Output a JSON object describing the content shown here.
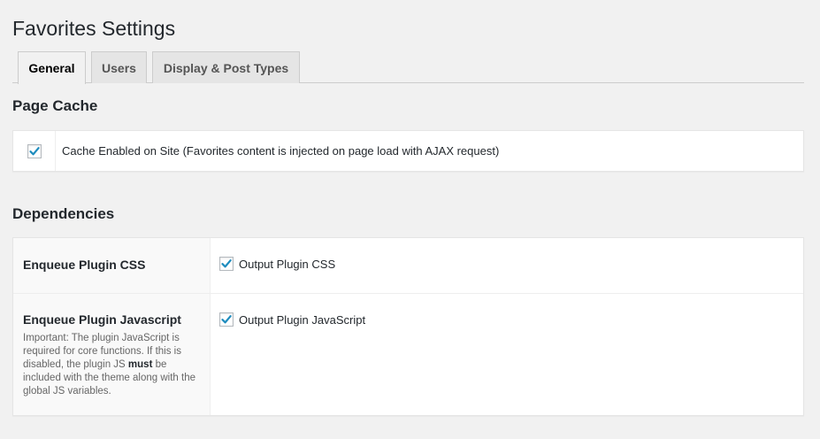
{
  "page": {
    "title": "Favorites Settings"
  },
  "tabs": [
    {
      "label": "General",
      "active": true
    },
    {
      "label": "Users",
      "active": false
    },
    {
      "label": "Display & Post Types",
      "active": false
    }
  ],
  "page_cache": {
    "heading": "Page Cache",
    "option": {
      "label": "Cache Enabled on Site (Favorites content is injected on page load with AJAX request)",
      "checked": true
    }
  },
  "dependencies": {
    "heading": "Dependencies",
    "rows": [
      {
        "title": "Enqueue Plugin CSS",
        "option_label": "Output Plugin CSS",
        "checked": true
      },
      {
        "title": "Enqueue Plugin Javascript",
        "help_before": "Important: The plugin JavaScript is required for core functions. If this is disabled, the plugin JS ",
        "help_strong": "must",
        "help_after": " be included with the theme along with the global JS variables.",
        "option_label": "Output Plugin JavaScript",
        "checked": true
      }
    ]
  },
  "colors": {
    "check": "#1e8cbe",
    "background": "#f1f1f1"
  },
  "icons": {
    "checkmark": "checkmark-icon"
  }
}
